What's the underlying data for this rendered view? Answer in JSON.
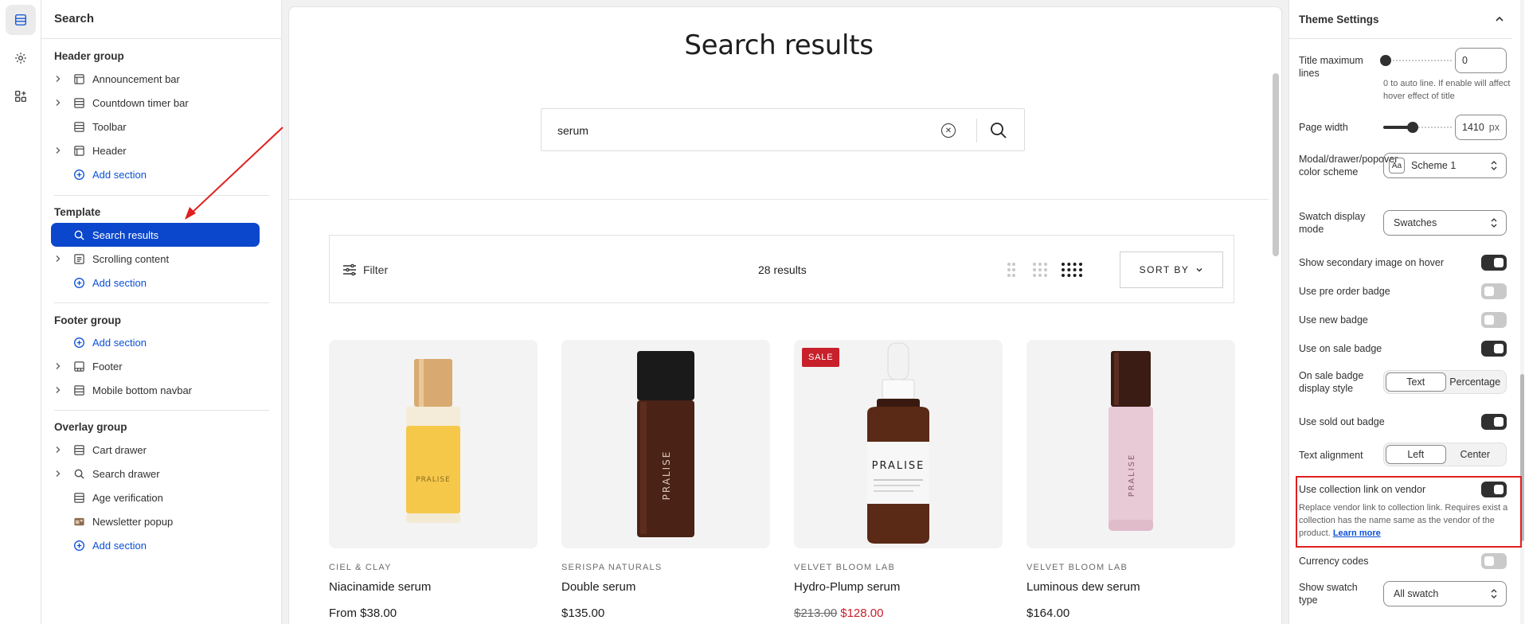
{
  "sidebar": {
    "title": "Search",
    "groups": [
      {
        "title": "Header group",
        "items": [
          {
            "label": "Announcement bar"
          },
          {
            "label": "Countdown timer bar"
          },
          {
            "label": "Toolbar"
          },
          {
            "label": "Header"
          },
          {
            "label": "Add section"
          }
        ]
      },
      {
        "title": "Template",
        "items": [
          {
            "label": "Search results"
          },
          {
            "label": "Scrolling content"
          },
          {
            "label": "Add section"
          }
        ]
      },
      {
        "title": "Footer group",
        "items": [
          {
            "label": "Add section"
          },
          {
            "label": "Footer"
          },
          {
            "label": "Mobile bottom navbar"
          }
        ]
      },
      {
        "title": "Overlay group",
        "items": [
          {
            "label": "Cart drawer"
          },
          {
            "label": "Search drawer"
          },
          {
            "label": "Age verification"
          },
          {
            "label": "Newsletter popup"
          },
          {
            "label": "Add section"
          }
        ]
      }
    ]
  },
  "preview": {
    "title": "Search results",
    "search_value": "serum",
    "filter_label": "Filter",
    "results_count": "28 results",
    "sort_label": "SORT BY",
    "products": [
      {
        "vendor": "CIEL & CLAY",
        "name": "Niacinamide serum",
        "price": "From $38.00",
        "bottle_text": "PRALISE",
        "badge": ""
      },
      {
        "vendor": "SERISPA NATURALS",
        "name": "Double serum",
        "price": "$135.00",
        "bottle_text": "PRALISE",
        "badge": ""
      },
      {
        "vendor": "VELVET BLOOM LAB",
        "name": "Hydro-Plump serum",
        "price_old": "$213.00",
        "price_new": "$128.00",
        "bottle_text": "PRALISE",
        "badge": "SALE"
      },
      {
        "vendor": "VELVET BLOOM LAB",
        "name": "Luminous dew serum",
        "price": "$164.00",
        "bottle_text": "PRALISE",
        "badge": ""
      }
    ]
  },
  "settings": {
    "title": "Theme Settings",
    "title_max_lines": {
      "label": "Title maximum lines",
      "value": "0",
      "help": "0 to auto line. If enable will affect hover effect of title",
      "level": 0
    },
    "page_width": {
      "label": "Page width",
      "value": "1410",
      "unit": "px",
      "level": 0.4
    },
    "modal_scheme": {
      "label": "Modal/drawer/popover color scheme",
      "value": "Scheme 1",
      "swatch_text": "Aa"
    },
    "swatch_mode": {
      "label": "Swatch display mode",
      "value": "Swatches"
    },
    "show_secondary": {
      "label": "Show secondary image on hover",
      "on": true
    },
    "pre_order": {
      "label": "Use pre order badge",
      "on": false
    },
    "new_badge": {
      "label": "Use new badge",
      "on": false
    },
    "sale_badge": {
      "label": "Use on sale badge",
      "on": true
    },
    "sale_style": {
      "label": "On sale badge display style",
      "options": [
        "Text",
        "Percentage"
      ],
      "selected": "Text"
    },
    "sold_out": {
      "label": "Use sold out badge",
      "on": true
    },
    "text_align": {
      "label": "Text alignment",
      "options": [
        "Left",
        "Center"
      ],
      "selected": "Left"
    },
    "collection_link": {
      "label": "Use collection link on vendor",
      "on": true,
      "help": "Replace vendor link to collection link. Requires exist a collection has the name same as the vendor of the product.",
      "link": "Learn more"
    },
    "currency_codes": {
      "label": "Currency codes",
      "on": false
    },
    "swatch_type": {
      "label": "Show swatch type",
      "value": "All swatch"
    }
  },
  "colors": {
    "accent": "#0b47cc",
    "link": "#0b50d6",
    "sale": "#c8202a",
    "highlight": "#e02020"
  }
}
